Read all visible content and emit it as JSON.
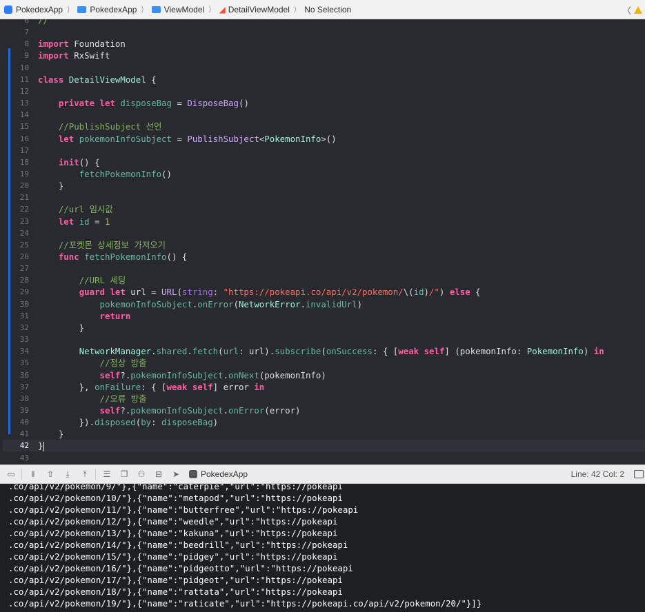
{
  "jumpbar": {
    "crumbs": [
      {
        "icon": "app-icon",
        "label": "PokedexApp"
      },
      {
        "icon": "folder-icon",
        "label": "PokedexApp"
      },
      {
        "icon": "folder-icon",
        "label": "ViewModel"
      },
      {
        "icon": "swift-file-icon",
        "label": "DetailViewModel"
      },
      {
        "icon": "",
        "label": "No Selection"
      }
    ]
  },
  "editor": {
    "current_line": 42,
    "lines": [
      {
        "n": "6",
        "tokens": [
          {
            "c": "cm",
            "t": "//"
          }
        ]
      },
      {
        "n": "7",
        "tokens": []
      },
      {
        "n": "8",
        "tokens": [
          {
            "c": "kw",
            "t": "import"
          },
          {
            "c": "pl",
            "t": " Foundation"
          }
        ]
      },
      {
        "n": "9",
        "tokens": [
          {
            "c": "kw",
            "t": "import"
          },
          {
            "c": "pl",
            "t": " RxSwift"
          }
        ]
      },
      {
        "n": "10",
        "tokens": []
      },
      {
        "n": "11",
        "tokens": [
          {
            "c": "kw",
            "t": "class"
          },
          {
            "c": "pl",
            "t": " "
          },
          {
            "c": "tv",
            "t": "DetailViewModel"
          },
          {
            "c": "pl",
            "t": " {"
          }
        ]
      },
      {
        "n": "12",
        "tokens": []
      },
      {
        "n": "13",
        "tokens": [
          {
            "c": "pl",
            "t": "    "
          },
          {
            "c": "kw",
            "t": "private let"
          },
          {
            "c": "pl",
            "t": " "
          },
          {
            "c": "vr",
            "t": "disposeBag"
          },
          {
            "c": "pl",
            "t": " = "
          },
          {
            "c": "ty",
            "t": "DisposeBag"
          },
          {
            "c": "pl",
            "t": "()"
          }
        ]
      },
      {
        "n": "14",
        "tokens": []
      },
      {
        "n": "15",
        "tokens": [
          {
            "c": "pl",
            "t": "    "
          },
          {
            "c": "cm",
            "t": "//PublishSubject 선언"
          }
        ]
      },
      {
        "n": "16",
        "tokens": [
          {
            "c": "pl",
            "t": "    "
          },
          {
            "c": "kw",
            "t": "let"
          },
          {
            "c": "pl",
            "t": " "
          },
          {
            "c": "vr",
            "t": "pokemonInfoSubject"
          },
          {
            "c": "pl",
            "t": " = "
          },
          {
            "c": "ty",
            "t": "PublishSubject"
          },
          {
            "c": "pl",
            "t": "<"
          },
          {
            "c": "tv",
            "t": "PokemonInfo"
          },
          {
            "c": "pl",
            "t": ">()"
          }
        ]
      },
      {
        "n": "17",
        "tokens": []
      },
      {
        "n": "18",
        "tokens": [
          {
            "c": "pl",
            "t": "    "
          },
          {
            "c": "kw",
            "t": "init"
          },
          {
            "c": "pl",
            "t": "() {"
          }
        ]
      },
      {
        "n": "19",
        "tokens": [
          {
            "c": "pl",
            "t": "        "
          },
          {
            "c": "fn",
            "t": "fetchPokemonInfo"
          },
          {
            "c": "pl",
            "t": "()"
          }
        ]
      },
      {
        "n": "20",
        "tokens": [
          {
            "c": "pl",
            "t": "    }"
          }
        ]
      },
      {
        "n": "21",
        "tokens": []
      },
      {
        "n": "22",
        "tokens": [
          {
            "c": "pl",
            "t": "    "
          },
          {
            "c": "cm",
            "t": "//url 임시값"
          }
        ]
      },
      {
        "n": "23",
        "tokens": [
          {
            "c": "pl",
            "t": "    "
          },
          {
            "c": "kw",
            "t": "let"
          },
          {
            "c": "pl",
            "t": " "
          },
          {
            "c": "vr",
            "t": "id"
          },
          {
            "c": "pl",
            "t": " = "
          },
          {
            "c": "nm",
            "t": "1"
          }
        ]
      },
      {
        "n": "24",
        "tokens": []
      },
      {
        "n": "25",
        "tokens": [
          {
            "c": "pl",
            "t": "    "
          },
          {
            "c": "cm",
            "t": "//포켓몬 상세정보 가져오기"
          }
        ]
      },
      {
        "n": "26",
        "tokens": [
          {
            "c": "pl",
            "t": "    "
          },
          {
            "c": "kw",
            "t": "func"
          },
          {
            "c": "pl",
            "t": " "
          },
          {
            "c": "vr",
            "t": "fetchPokemonInfo"
          },
          {
            "c": "pl",
            "t": "() {"
          }
        ]
      },
      {
        "n": "27",
        "tokens": []
      },
      {
        "n": "28",
        "tokens": [
          {
            "c": "pl",
            "t": "        "
          },
          {
            "c": "cm",
            "t": "//URL 세팅"
          }
        ]
      },
      {
        "n": "29",
        "tokens": [
          {
            "c": "pl",
            "t": "        "
          },
          {
            "c": "kw",
            "t": "guard let"
          },
          {
            "c": "pl",
            "t": " url = "
          },
          {
            "c": "ty",
            "t": "URL"
          },
          {
            "c": "pl",
            "t": "("
          },
          {
            "c": "pm",
            "t": "string"
          },
          {
            "c": "pl",
            "t": ": "
          },
          {
            "c": "st",
            "t": "\"https://pokeapi.co/api/v2/pokemon/"
          },
          {
            "c": "pl",
            "t": "\\("
          },
          {
            "c": "fn",
            "t": "id"
          },
          {
            "c": "pl",
            "t": ")"
          },
          {
            "c": "st",
            "t": "/\""
          },
          {
            "c": "pl",
            "t": ") "
          },
          {
            "c": "kw",
            "t": "else"
          },
          {
            "c": "pl",
            "t": " {"
          }
        ]
      },
      {
        "n": "30",
        "tokens": [
          {
            "c": "pl",
            "t": "            "
          },
          {
            "c": "fn",
            "t": "pokemonInfoSubject"
          },
          {
            "c": "pl",
            "t": "."
          },
          {
            "c": "fn",
            "t": "onError"
          },
          {
            "c": "pl",
            "t": "("
          },
          {
            "c": "tv",
            "t": "NetworkError"
          },
          {
            "c": "pl",
            "t": "."
          },
          {
            "c": "fn",
            "t": "invalidUrl"
          },
          {
            "c": "pl",
            "t": ")"
          }
        ]
      },
      {
        "n": "31",
        "tokens": [
          {
            "c": "pl",
            "t": "            "
          },
          {
            "c": "kw",
            "t": "return"
          }
        ]
      },
      {
        "n": "32",
        "tokens": [
          {
            "c": "pl",
            "t": "        }"
          }
        ]
      },
      {
        "n": "33",
        "tokens": []
      },
      {
        "n": "34",
        "tokens": [
          {
            "c": "pl",
            "t": "        "
          },
          {
            "c": "tv",
            "t": "NetworkManager"
          },
          {
            "c": "pl",
            "t": "."
          },
          {
            "c": "fn",
            "t": "shared"
          },
          {
            "c": "pl",
            "t": "."
          },
          {
            "c": "fn",
            "t": "fetch"
          },
          {
            "c": "pl",
            "t": "("
          },
          {
            "c": "fn",
            "t": "url"
          },
          {
            "c": "pl",
            "t": ": url)."
          },
          {
            "c": "fn",
            "t": "subscribe"
          },
          {
            "c": "pl",
            "t": "("
          },
          {
            "c": "fn",
            "t": "onSuccess"
          },
          {
            "c": "pl",
            "t": ": { ["
          },
          {
            "c": "kw",
            "t": "weak self"
          },
          {
            "c": "pl",
            "t": "] (pokemonInfo: "
          },
          {
            "c": "tv",
            "t": "PokemonInfo"
          },
          {
            "c": "pl",
            "t": ") "
          },
          {
            "c": "kw",
            "t": "in"
          }
        ]
      },
      {
        "n": "35",
        "tokens": [
          {
            "c": "pl",
            "t": "            "
          },
          {
            "c": "cm",
            "t": "//정상 방출"
          }
        ]
      },
      {
        "n": "36",
        "tokens": [
          {
            "c": "pl",
            "t": "            "
          },
          {
            "c": "kw",
            "t": "self"
          },
          {
            "c": "pl",
            "t": "?."
          },
          {
            "c": "fn",
            "t": "pokemonInfoSubject"
          },
          {
            "c": "pl",
            "t": "."
          },
          {
            "c": "fn",
            "t": "onNext"
          },
          {
            "c": "pl",
            "t": "(pokemonInfo)"
          }
        ]
      },
      {
        "n": "37",
        "tokens": [
          {
            "c": "pl",
            "t": "        }, "
          },
          {
            "c": "fn",
            "t": "onFailure"
          },
          {
            "c": "pl",
            "t": ": { ["
          },
          {
            "c": "kw",
            "t": "weak self"
          },
          {
            "c": "pl",
            "t": "] error "
          },
          {
            "c": "kw",
            "t": "in"
          }
        ]
      },
      {
        "n": "38",
        "tokens": [
          {
            "c": "pl",
            "t": "            "
          },
          {
            "c": "cm",
            "t": "//오류 방출"
          }
        ]
      },
      {
        "n": "39",
        "tokens": [
          {
            "c": "pl",
            "t": "            "
          },
          {
            "c": "kw",
            "t": "self"
          },
          {
            "c": "pl",
            "t": "?."
          },
          {
            "c": "fn",
            "t": "pokemonInfoSubject"
          },
          {
            "c": "pl",
            "t": "."
          },
          {
            "c": "fn",
            "t": "onError"
          },
          {
            "c": "pl",
            "t": "(error)"
          }
        ]
      },
      {
        "n": "40",
        "tokens": [
          {
            "c": "pl",
            "t": "        })."
          },
          {
            "c": "fn",
            "t": "disposed"
          },
          {
            "c": "pl",
            "t": "("
          },
          {
            "c": "fn",
            "t": "by"
          },
          {
            "c": "pl",
            "t": ": "
          },
          {
            "c": "fn",
            "t": "disposeBag"
          },
          {
            "c": "pl",
            "t": ")"
          }
        ]
      },
      {
        "n": "41",
        "tokens": [
          {
            "c": "pl",
            "t": "    }"
          }
        ]
      },
      {
        "n": "42",
        "tokens": [
          {
            "c": "pl",
            "t": "}"
          }
        ]
      },
      {
        "n": "43",
        "tokens": []
      }
    ]
  },
  "debugbar": {
    "target_label": "PokedexApp",
    "position": "Line: 42  Col: 2"
  },
  "console": {
    "lines": [
      ".co/api/v2/pokemon/9/\"},{\"name\":\"caterpie\",\"url\":\"https://pokeapi",
      ".co/api/v2/pokemon/10/\"},{\"name\":\"metapod\",\"url\":\"https://pokeapi",
      ".co/api/v2/pokemon/11/\"},{\"name\":\"butterfree\",\"url\":\"https://pokeapi",
      ".co/api/v2/pokemon/12/\"},{\"name\":\"weedle\",\"url\":\"https://pokeapi",
      ".co/api/v2/pokemon/13/\"},{\"name\":\"kakuna\",\"url\":\"https://pokeapi",
      ".co/api/v2/pokemon/14/\"},{\"name\":\"beedrill\",\"url\":\"https://pokeapi",
      ".co/api/v2/pokemon/15/\"},{\"name\":\"pidgey\",\"url\":\"https://pokeapi",
      ".co/api/v2/pokemon/16/\"},{\"name\":\"pidgeotto\",\"url\":\"https://pokeapi",
      ".co/api/v2/pokemon/17/\"},{\"name\":\"pidgeot\",\"url\":\"https://pokeapi",
      ".co/api/v2/pokemon/18/\"},{\"name\":\"rattata\",\"url\":\"https://pokeapi",
      ".co/api/v2/pokemon/19/\"},{\"name\":\"raticate\",\"url\":\"https://pokeapi.co/api/v2/pokemon/20/\"}]}"
    ]
  }
}
